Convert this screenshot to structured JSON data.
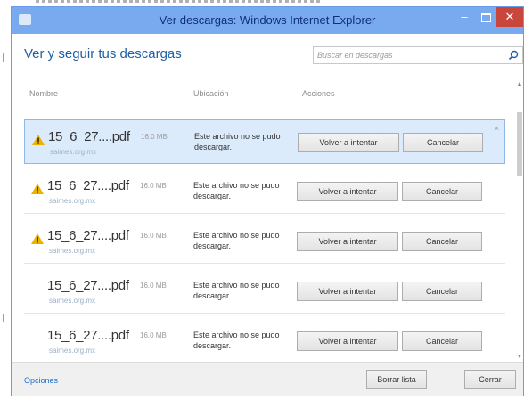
{
  "window": {
    "title": "Ver descargas: Windows Internet Explorer",
    "minimize_label": "–",
    "close_label": "✕"
  },
  "heading": "Ver y seguir tus descargas",
  "search": {
    "placeholder": "Buscar en descargas"
  },
  "columns": {
    "name": "Nombre",
    "location": "Ubicación",
    "actions": "Acciones"
  },
  "downloads": [
    {
      "file_name": "15_6_27....pdf",
      "size": "16.0 MB",
      "domain": "saimes.org.mx",
      "status": "Este archivo no se pudo descargar.",
      "retry_label": "Volver a intentar",
      "cancel_label": "Cancelar",
      "warning": true,
      "selected": true,
      "close_label": "×"
    },
    {
      "file_name": "15_6_27....pdf",
      "size": "16.0 MB",
      "domain": "saimes.org.mx",
      "status": "Este archivo no se pudo descargar.",
      "retry_label": "Volver a intentar",
      "cancel_label": "Cancelar",
      "warning": true,
      "selected": false
    },
    {
      "file_name": "15_6_27....pdf",
      "size": "16.0 MB",
      "domain": "saimes.org.mx",
      "status": "Este archivo no se pudo descargar.",
      "retry_label": "Volver a intentar",
      "cancel_label": "Cancelar",
      "warning": true,
      "selected": false
    },
    {
      "file_name": "15_6_27....pdf",
      "size": "16.0 MB",
      "domain": "saimes.org.mx",
      "status": "Este archivo no se pudo descargar.",
      "retry_label": "Volver a intentar",
      "cancel_label": "Cancelar",
      "warning": false,
      "selected": false
    },
    {
      "file_name": "15_6_27....pdf",
      "size": "16.0 MB",
      "domain": "saimes.org.mx",
      "status": "Este archivo no se pudo descargar.",
      "retry_label": "Volver a intentar",
      "cancel_label": "Cancelar",
      "warning": false,
      "selected": false
    }
  ],
  "footer": {
    "options_label": "Opciones",
    "clear_list_label": "Borrar lista",
    "close_label": "Cerrar"
  },
  "colors": {
    "titlebar": "#79a9ee",
    "accent": "#1f5fa7",
    "close_button": "#c9463d",
    "warning": "#e8b400",
    "selected_row": "#dcebfb"
  },
  "icons": {
    "warning": "warning-icon",
    "search": "search-icon"
  }
}
